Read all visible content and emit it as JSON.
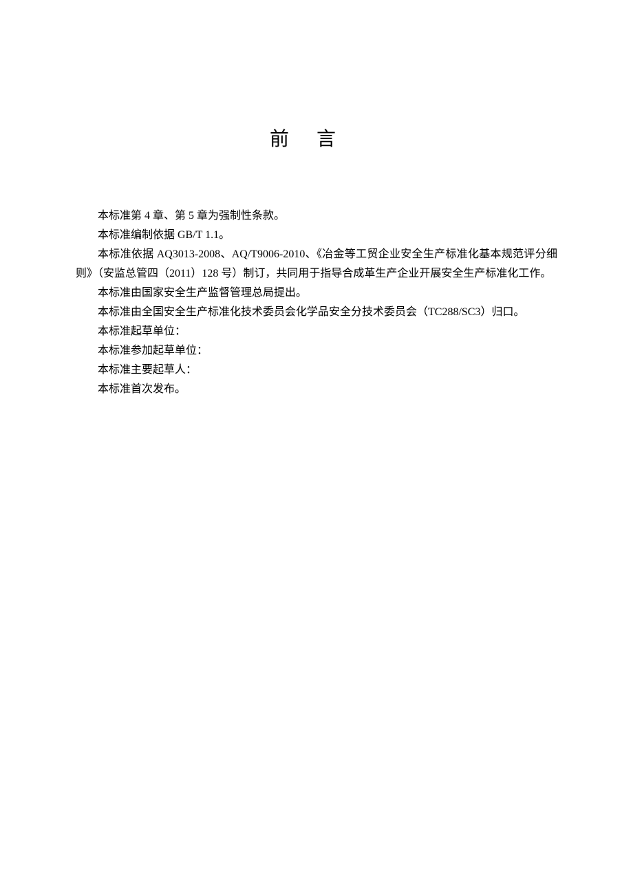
{
  "title": "前言",
  "paragraphs": [
    "本标准第 4 章、第 5 章为强制性条款。",
    "本标准编制依据 GB/T 1.1。",
    "本标准依据 AQ3013-2008、AQ/T9006-2010、《冶金等工贸企业安全生产标准化基本规范评分细则》（安监总管四（2011）128 号）制订，共同用于指导合成革生产企业开展安全生产标准化工作。",
    "本标准由国家安全生产监督管理总局提出。",
    "本标准由全国安全生产标准化技术委员会化学品安全分技术委员会（TC288/SC3）归口。",
    "本标准起草单位：",
    "本标准参加起草单位：",
    "本标准主要起草人：",
    "本标准首次发布。"
  ]
}
